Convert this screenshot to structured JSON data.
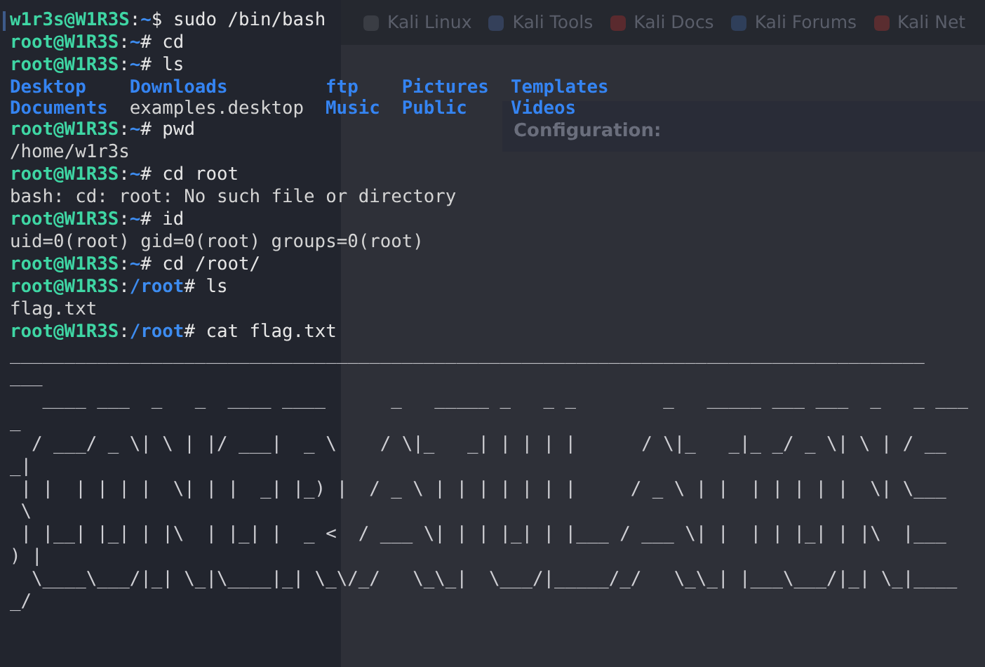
{
  "background_window": {
    "bookmarks": [
      {
        "label": "Kali Linux",
        "color": "#3a3d44"
      },
      {
        "label": "Kali Tools",
        "color": "#34405a"
      },
      {
        "label": "Kali Docs",
        "color": "#5a2a2e"
      },
      {
        "label": "Kali Forums",
        "color": "#2f3f5a"
      },
      {
        "label": "Kali Net",
        "color": "#5a2d30"
      }
    ],
    "panel_title": "Configuration:"
  },
  "terminal": {
    "lines": [
      {
        "kind": "prompt",
        "user_host": "w1r3s@W1R3S",
        "separator": ":",
        "path": "~",
        "symbol": "$",
        "command": "sudo /bin/bash"
      },
      {
        "kind": "prompt",
        "user_host": "root@W1R3S",
        "separator": ":",
        "path": "~",
        "symbol": "#",
        "command": "cd"
      },
      {
        "kind": "prompt",
        "user_host": "root@W1R3S",
        "separator": ":",
        "path": "~",
        "symbol": "#",
        "command": "ls"
      },
      {
        "kind": "listing",
        "items": [
          {
            "name": "Desktop",
            "is_dir": true
          },
          {
            "name": "Downloads",
            "is_dir": true
          },
          {
            "name": "ftp",
            "is_dir": true
          },
          {
            "name": "Pictures",
            "is_dir": true
          },
          {
            "name": "Templates",
            "is_dir": true
          },
          {
            "name": "Documents",
            "is_dir": true
          },
          {
            "name": "examples.desktop",
            "is_dir": false
          },
          {
            "name": "Music",
            "is_dir": true
          },
          {
            "name": "Public",
            "is_dir": true
          },
          {
            "name": "Videos",
            "is_dir": true
          }
        ]
      },
      {
        "kind": "prompt",
        "user_host": "root@W1R3S",
        "separator": ":",
        "path": "~",
        "symbol": "#",
        "command": "pwd"
      },
      {
        "kind": "output",
        "text": "/home/w1r3s"
      },
      {
        "kind": "prompt",
        "user_host": "root@W1R3S",
        "separator": ":",
        "path": "~",
        "symbol": "#",
        "command": "cd root"
      },
      {
        "kind": "output",
        "text": "bash: cd: root: No such file or directory"
      },
      {
        "kind": "prompt",
        "user_host": "root@W1R3S",
        "separator": ":",
        "path": "~",
        "symbol": "#",
        "command": "id"
      },
      {
        "kind": "output",
        "text": "uid=0(root) gid=0(root) groups=0(root)"
      },
      {
        "kind": "prompt",
        "user_host": "root@W1R3S",
        "separator": ":",
        "path": "~",
        "symbol": "#",
        "command": "cd /root/"
      },
      {
        "kind": "prompt",
        "user_host": "root@W1R3S",
        "separator": ":",
        "path": "/root",
        "symbol": "#",
        "command": "ls"
      },
      {
        "kind": "output",
        "text": "flag.txt"
      },
      {
        "kind": "prompt",
        "user_host": "root@W1R3S",
        "separator": ":",
        "path": "/root",
        "symbol": "#",
        "command": "cat flag.txt"
      },
      {
        "kind": "art",
        "text": "____________________________________________________________________________________"
      },
      {
        "kind": "art",
        "text": "___"
      },
      {
        "kind": "art",
        "text": "   ____ ___  _   _  ____ ____      _   _____ _   _ _        _   _____ ___ ___  _   _ ___"
      },
      {
        "kind": "art",
        "text": "_"
      },
      {
        "kind": "art",
        "text": "  / ___/ _ \\| \\ | |/ ___|  _ \\    / \\|_   _| | | | |      / \\|_   _|_ _/ _ \\| \\ | / __"
      },
      {
        "kind": "art",
        "text": "_|"
      },
      {
        "kind": "art",
        "text": " | |  | | | |  \\| | |  _| |_) |  / _ \\ | | | | | | |     / _ \\ | |  | | | | |  \\| \\___"
      },
      {
        "kind": "art",
        "text": " \\"
      },
      {
        "kind": "art",
        "text": " | |__| |_| | |\\  | |_| |  _ <  / ___ \\| | | |_| | |___ / ___ \\| |  | | |_| | |\\  |___"
      },
      {
        "kind": "art",
        "text": ") |"
      },
      {
        "kind": "art",
        "text": "  \\____\\___/|_| \\_|\\____|_| \\_\\/_/   \\_\\_|  \\___/|_____/_/   \\_\\_| |___\\___/|_| \\_|____"
      },
      {
        "kind": "art",
        "text": "_/"
      }
    ]
  }
}
